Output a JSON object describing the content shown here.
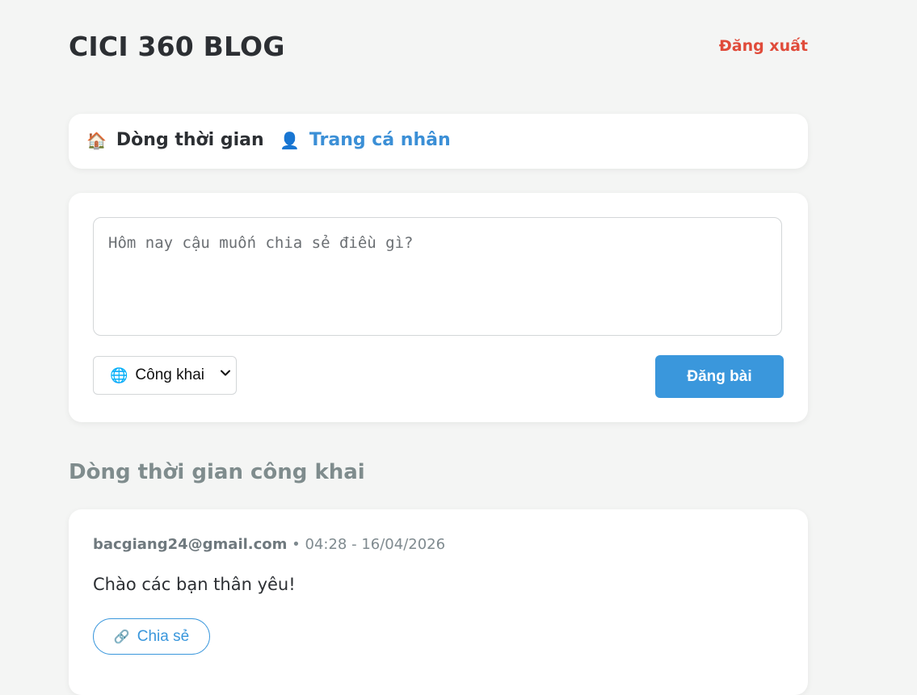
{
  "header": {
    "title": "CICI 360 BLOG",
    "logout_label": "Đăng xuất"
  },
  "nav": {
    "timeline": {
      "icon": "🏠",
      "label": "Dòng thời gian"
    },
    "profile": {
      "icon": "👤",
      "label": "Trang cá nhân"
    }
  },
  "composer": {
    "placeholder": "Hôm nay cậu muốn chia sẻ điều gì?",
    "privacy": {
      "icon": "🌐",
      "selected": "Công khai"
    },
    "post_label": "Đăng bài"
  },
  "feed": {
    "title": "Dòng thời gian công khai",
    "posts": [
      {
        "author": "bacgiang24@gmail.com",
        "separator": "•",
        "timestamp": "04:28 - 16/04/2026",
        "content": "Chào các bạn thân yêu!",
        "share_icon": "🔗",
        "share_label": "Chia sẻ"
      }
    ]
  },
  "colors": {
    "accent": "#3a97dc",
    "danger": "#e04b3a",
    "background": "#f4f5f4"
  }
}
